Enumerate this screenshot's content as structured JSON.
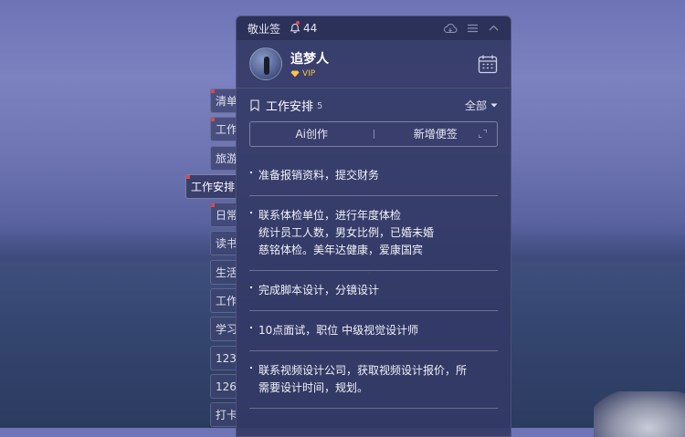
{
  "side_tabs": [
    {
      "label": "清单",
      "dot": true
    },
    {
      "label": "工作",
      "dot": true
    },
    {
      "label": "旅游",
      "dot": false
    },
    {
      "label": "工作安排",
      "dot": true,
      "active": true
    },
    {
      "label": "日常",
      "dot": true
    },
    {
      "label": "读书",
      "dot": false
    },
    {
      "label": "生活",
      "dot": false
    },
    {
      "label": "工作",
      "dot": false
    },
    {
      "label": "学习",
      "dot": false
    },
    {
      "label": "123",
      "dot": false
    },
    {
      "label": "126",
      "dot": false
    },
    {
      "label": "打卡",
      "dot": false
    }
  ],
  "titlebar": {
    "app_name": "敬业签",
    "notification_count": "44"
  },
  "profile": {
    "username": "追梦人",
    "vip_label": "VIP"
  },
  "section": {
    "title": "工作安排",
    "count": "5",
    "filter_label": "全部"
  },
  "actions": {
    "ai_label": "Ai创作",
    "new_note_label": "新增便签"
  },
  "notes": [
    {
      "lines": [
        "准备报销资料，提交财务"
      ]
    },
    {
      "lines": [
        "联系体检单位，进行年度体检",
        "统计员工人数，男女比例，已婚未婚",
        "慈铭体检。美年达健康，爱康国宾"
      ]
    },
    {
      "lines": [
        "完成脚本设计，分镜设计"
      ]
    },
    {
      "lines": [
        "10点面试，职位 中级视觉设计师"
      ]
    },
    {
      "lines": [
        "联系视频设计公司，获取视频设计报价，所",
        "需要设计时间，规划。"
      ]
    }
  ],
  "colors": {
    "panel_bg": "#343a66",
    "accent_red": "#e04848",
    "vip_gold": "#f6c744"
  }
}
